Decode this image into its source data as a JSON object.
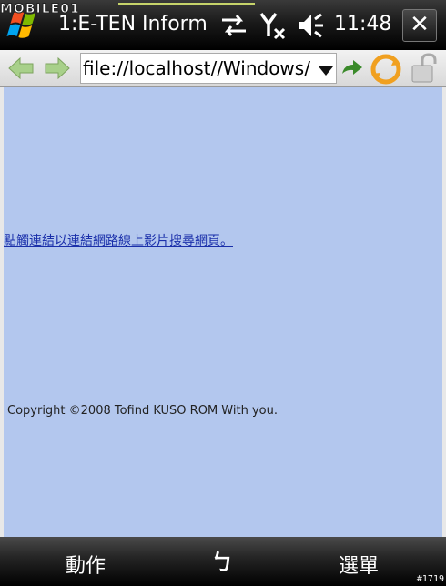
{
  "watermark": {
    "text": "MOBILE01"
  },
  "titlebar": {
    "title": "1:E-TEN Inform",
    "time": "11:48",
    "close_label": "✕",
    "icons": [
      "windows-start-icon",
      "sync-arrows-icon",
      "no-signal-icon",
      "speaker-icon"
    ]
  },
  "toolbar": {
    "url": "file://localhost//Windows/",
    "icons": [
      "back-arrow-icon",
      "forward-arrow-icon",
      "go-arrow-icon",
      "refresh-icon",
      "lock-icon"
    ]
  },
  "content": {
    "link_text": "點觸連結以連結網路線上影片搜尋網頁。",
    "copyright": "Copyright ©2008 Tofind KUSO ROM With you."
  },
  "softbar": {
    "left_key": "動作",
    "right_key": "選單",
    "input_indicator": "ㄅ",
    "counter": "#1719"
  },
  "colors": {
    "content_bg": "#b3c7ee",
    "link": "#1a2faa",
    "titlebar": "#1a1a1a"
  }
}
